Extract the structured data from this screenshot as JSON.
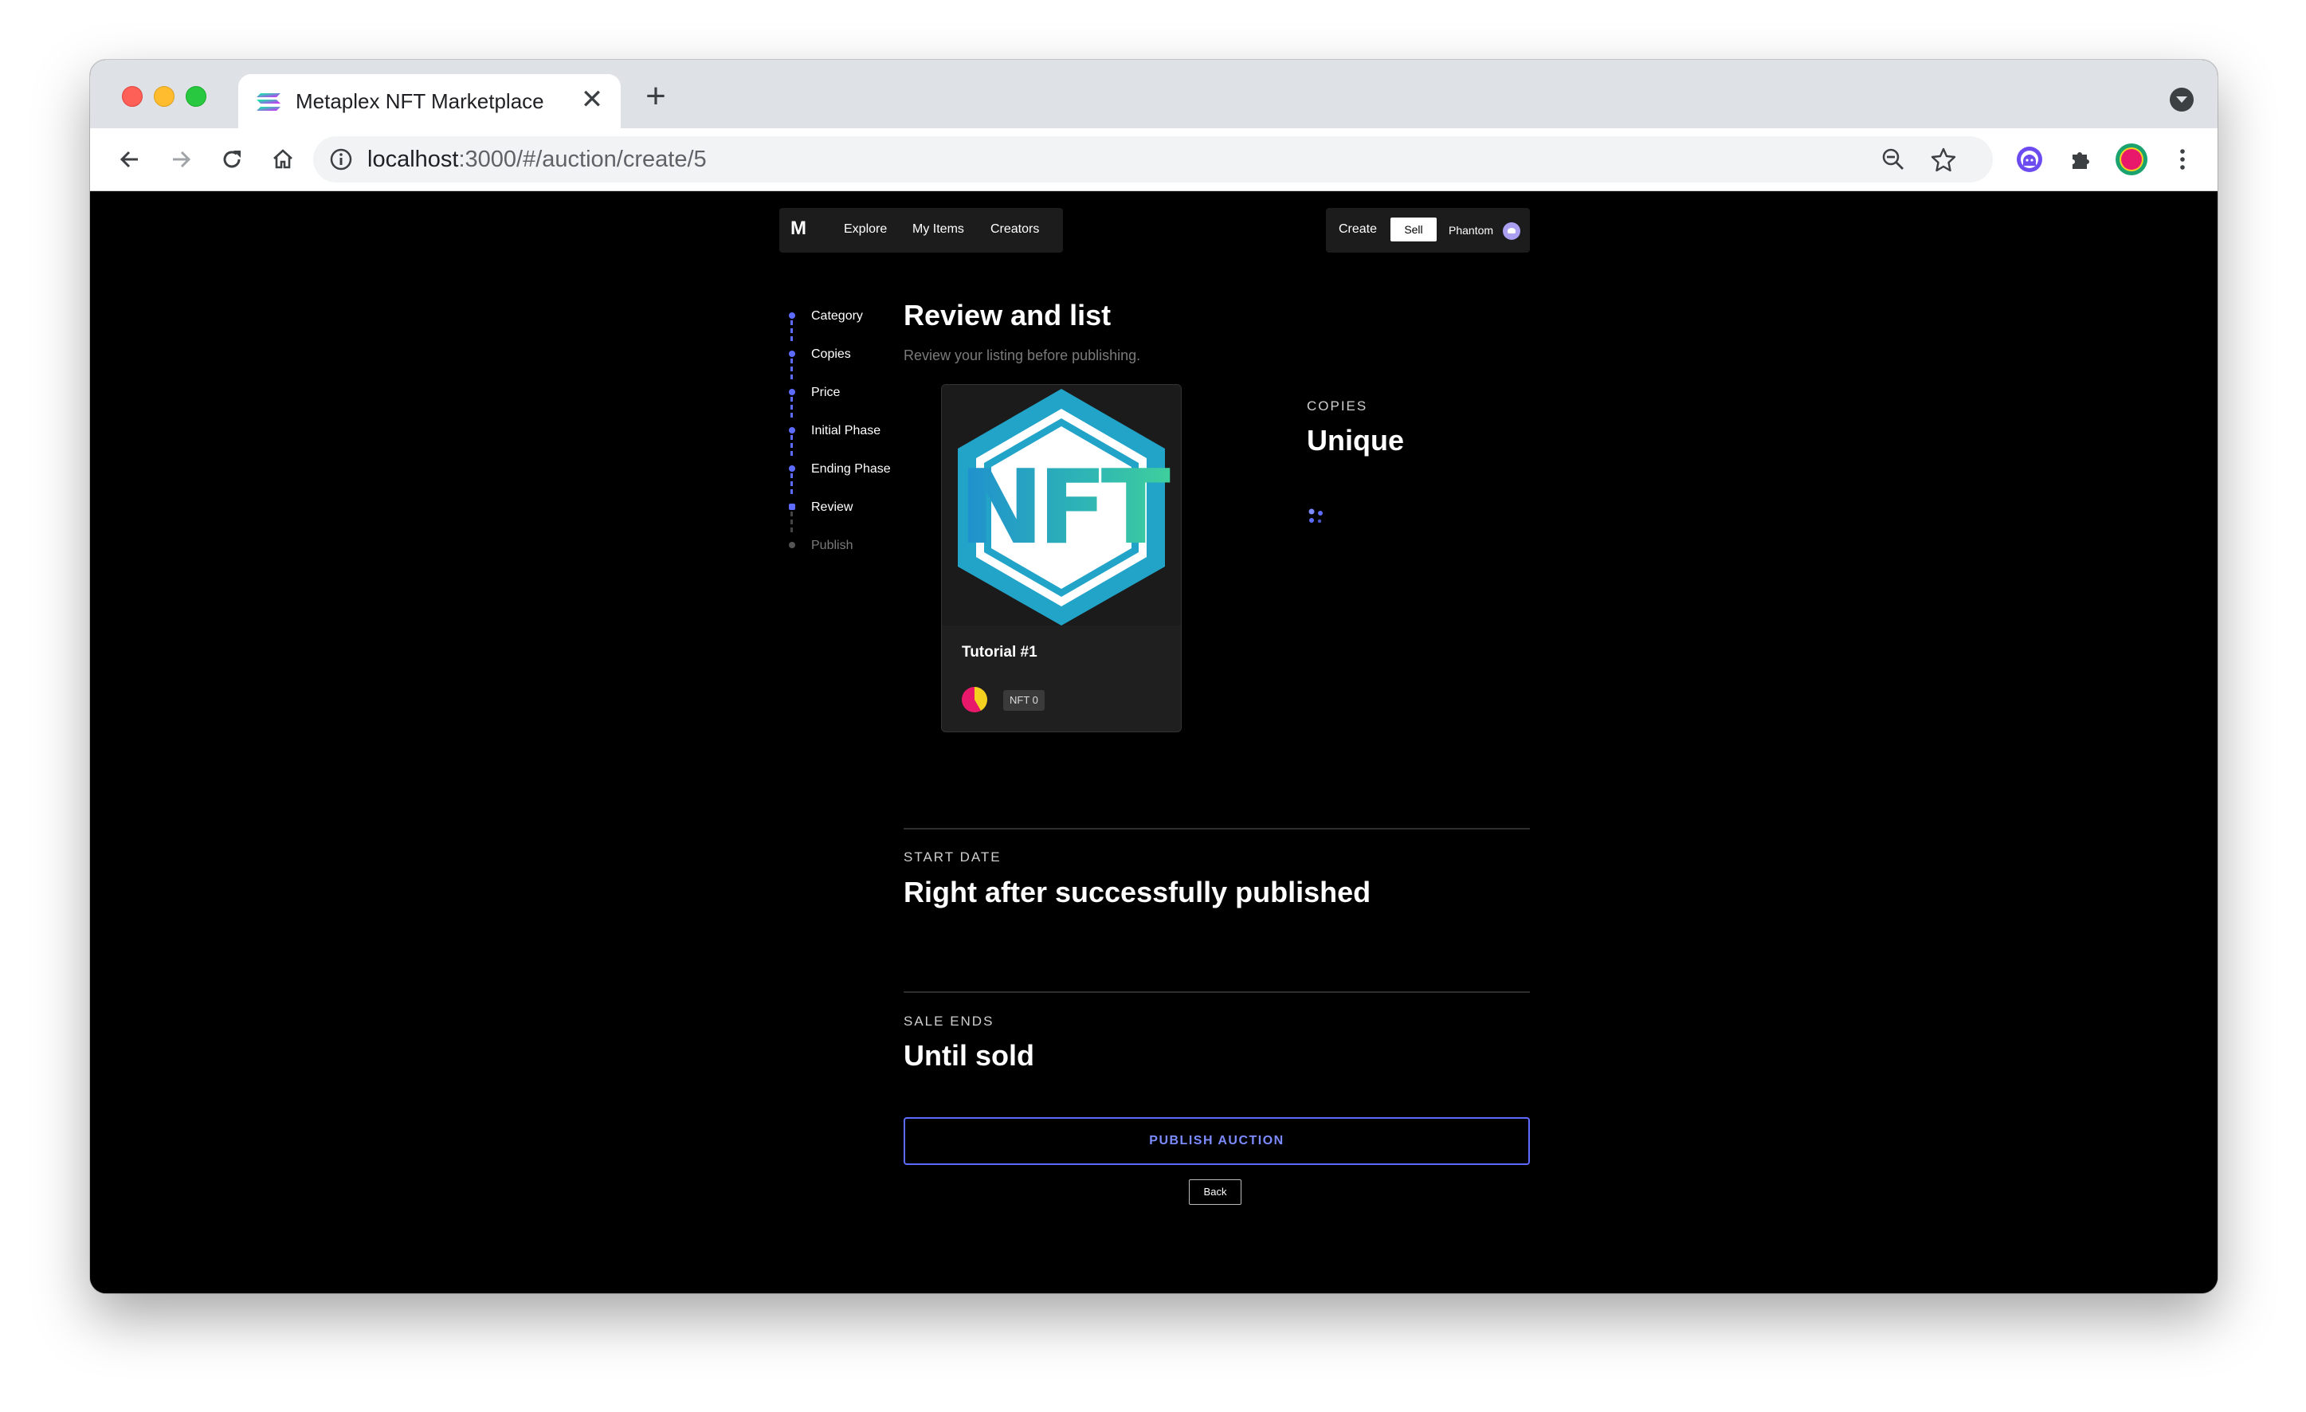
{
  "browser": {
    "tab_title": "Metaplex NFT Marketplace",
    "close_glyph": "✕",
    "new_tab_glyph": "+",
    "url_host": "localhost",
    "url_path": ":3000/#/auction/create/5"
  },
  "navbar": {
    "logo": "M",
    "links": [
      "Explore",
      "My Items",
      "Creators"
    ],
    "create_label": "Create",
    "sell_label": "Sell",
    "wallet_label": "Phantom"
  },
  "steps": {
    "items": [
      "Category",
      "Copies",
      "Price",
      "Initial Phase",
      "Ending Phase",
      "Review",
      "Publish"
    ],
    "current_index": 5
  },
  "review": {
    "title": "Review and list",
    "subtitle": "Review your listing before publishing."
  },
  "card": {
    "name": "Tutorial #1",
    "badge": "NFT 0",
    "art_text": "NFT"
  },
  "copies": {
    "label": "COPIES",
    "value": "Unique"
  },
  "start_date": {
    "label": "START DATE",
    "value": "Right after successfully published"
  },
  "sale_ends": {
    "label": "SALE ENDS",
    "value": "Until sold"
  },
  "actions": {
    "publish_label": "PUBLISH AUCTION",
    "back_label": "Back"
  },
  "colors": {
    "accent": "#5d6cff",
    "page_background": "#000000",
    "nft_teal": "#22a4c9",
    "nft_green": "#3ecf9c"
  }
}
